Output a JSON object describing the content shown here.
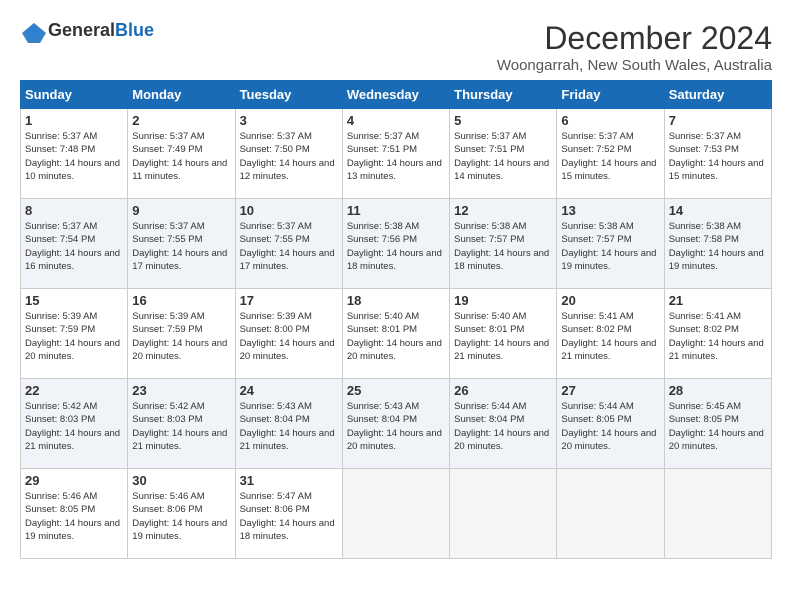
{
  "header": {
    "logo": {
      "general": "General",
      "blue": "Blue"
    },
    "title": "December 2024",
    "subtitle": "Woongarrah, New South Wales, Australia"
  },
  "calendar": {
    "weekdays": [
      "Sunday",
      "Monday",
      "Tuesday",
      "Wednesday",
      "Thursday",
      "Friday",
      "Saturday"
    ],
    "weeks": [
      [
        {
          "day": "1",
          "sunrise": "5:37 AM",
          "sunset": "7:48 PM",
          "daylight": "14 hours and 10 minutes."
        },
        {
          "day": "2",
          "sunrise": "5:37 AM",
          "sunset": "7:49 PM",
          "daylight": "14 hours and 11 minutes."
        },
        {
          "day": "3",
          "sunrise": "5:37 AM",
          "sunset": "7:50 PM",
          "daylight": "14 hours and 12 minutes."
        },
        {
          "day": "4",
          "sunrise": "5:37 AM",
          "sunset": "7:51 PM",
          "daylight": "14 hours and 13 minutes."
        },
        {
          "day": "5",
          "sunrise": "5:37 AM",
          "sunset": "7:51 PM",
          "daylight": "14 hours and 14 minutes."
        },
        {
          "day": "6",
          "sunrise": "5:37 AM",
          "sunset": "7:52 PM",
          "daylight": "14 hours and 15 minutes."
        },
        {
          "day": "7",
          "sunrise": "5:37 AM",
          "sunset": "7:53 PM",
          "daylight": "14 hours and 15 minutes."
        }
      ],
      [
        {
          "day": "8",
          "sunrise": "5:37 AM",
          "sunset": "7:54 PM",
          "daylight": "14 hours and 16 minutes."
        },
        {
          "day": "9",
          "sunrise": "5:37 AM",
          "sunset": "7:55 PM",
          "daylight": "14 hours and 17 minutes."
        },
        {
          "day": "10",
          "sunrise": "5:37 AM",
          "sunset": "7:55 PM",
          "daylight": "14 hours and 17 minutes."
        },
        {
          "day": "11",
          "sunrise": "5:38 AM",
          "sunset": "7:56 PM",
          "daylight": "14 hours and 18 minutes."
        },
        {
          "day": "12",
          "sunrise": "5:38 AM",
          "sunset": "7:57 PM",
          "daylight": "14 hours and 18 minutes."
        },
        {
          "day": "13",
          "sunrise": "5:38 AM",
          "sunset": "7:57 PM",
          "daylight": "14 hours and 19 minutes."
        },
        {
          "day": "14",
          "sunrise": "5:38 AM",
          "sunset": "7:58 PM",
          "daylight": "14 hours and 19 minutes."
        }
      ],
      [
        {
          "day": "15",
          "sunrise": "5:39 AM",
          "sunset": "7:59 PM",
          "daylight": "14 hours and 20 minutes."
        },
        {
          "day": "16",
          "sunrise": "5:39 AM",
          "sunset": "7:59 PM",
          "daylight": "14 hours and 20 minutes."
        },
        {
          "day": "17",
          "sunrise": "5:39 AM",
          "sunset": "8:00 PM",
          "daylight": "14 hours and 20 minutes."
        },
        {
          "day": "18",
          "sunrise": "5:40 AM",
          "sunset": "8:01 PM",
          "daylight": "14 hours and 20 minutes."
        },
        {
          "day": "19",
          "sunrise": "5:40 AM",
          "sunset": "8:01 PM",
          "daylight": "14 hours and 21 minutes."
        },
        {
          "day": "20",
          "sunrise": "5:41 AM",
          "sunset": "8:02 PM",
          "daylight": "14 hours and 21 minutes."
        },
        {
          "day": "21",
          "sunrise": "5:41 AM",
          "sunset": "8:02 PM",
          "daylight": "14 hours and 21 minutes."
        }
      ],
      [
        {
          "day": "22",
          "sunrise": "5:42 AM",
          "sunset": "8:03 PM",
          "daylight": "14 hours and 21 minutes."
        },
        {
          "day": "23",
          "sunrise": "5:42 AM",
          "sunset": "8:03 PM",
          "daylight": "14 hours and 21 minutes."
        },
        {
          "day": "24",
          "sunrise": "5:43 AM",
          "sunset": "8:04 PM",
          "daylight": "14 hours and 21 minutes."
        },
        {
          "day": "25",
          "sunrise": "5:43 AM",
          "sunset": "8:04 PM",
          "daylight": "14 hours and 20 minutes."
        },
        {
          "day": "26",
          "sunrise": "5:44 AM",
          "sunset": "8:04 PM",
          "daylight": "14 hours and 20 minutes."
        },
        {
          "day": "27",
          "sunrise": "5:44 AM",
          "sunset": "8:05 PM",
          "daylight": "14 hours and 20 minutes."
        },
        {
          "day": "28",
          "sunrise": "5:45 AM",
          "sunset": "8:05 PM",
          "daylight": "14 hours and 20 minutes."
        }
      ],
      [
        {
          "day": "29",
          "sunrise": "5:46 AM",
          "sunset": "8:05 PM",
          "daylight": "14 hours and 19 minutes."
        },
        {
          "day": "30",
          "sunrise": "5:46 AM",
          "sunset": "8:06 PM",
          "daylight": "14 hours and 19 minutes."
        },
        {
          "day": "31",
          "sunrise": "5:47 AM",
          "sunset": "8:06 PM",
          "daylight": "14 hours and 18 minutes."
        },
        null,
        null,
        null,
        null
      ]
    ],
    "labels": {
      "sunrise": "Sunrise:",
      "sunset": "Sunset:",
      "daylight": "Daylight hours"
    }
  }
}
